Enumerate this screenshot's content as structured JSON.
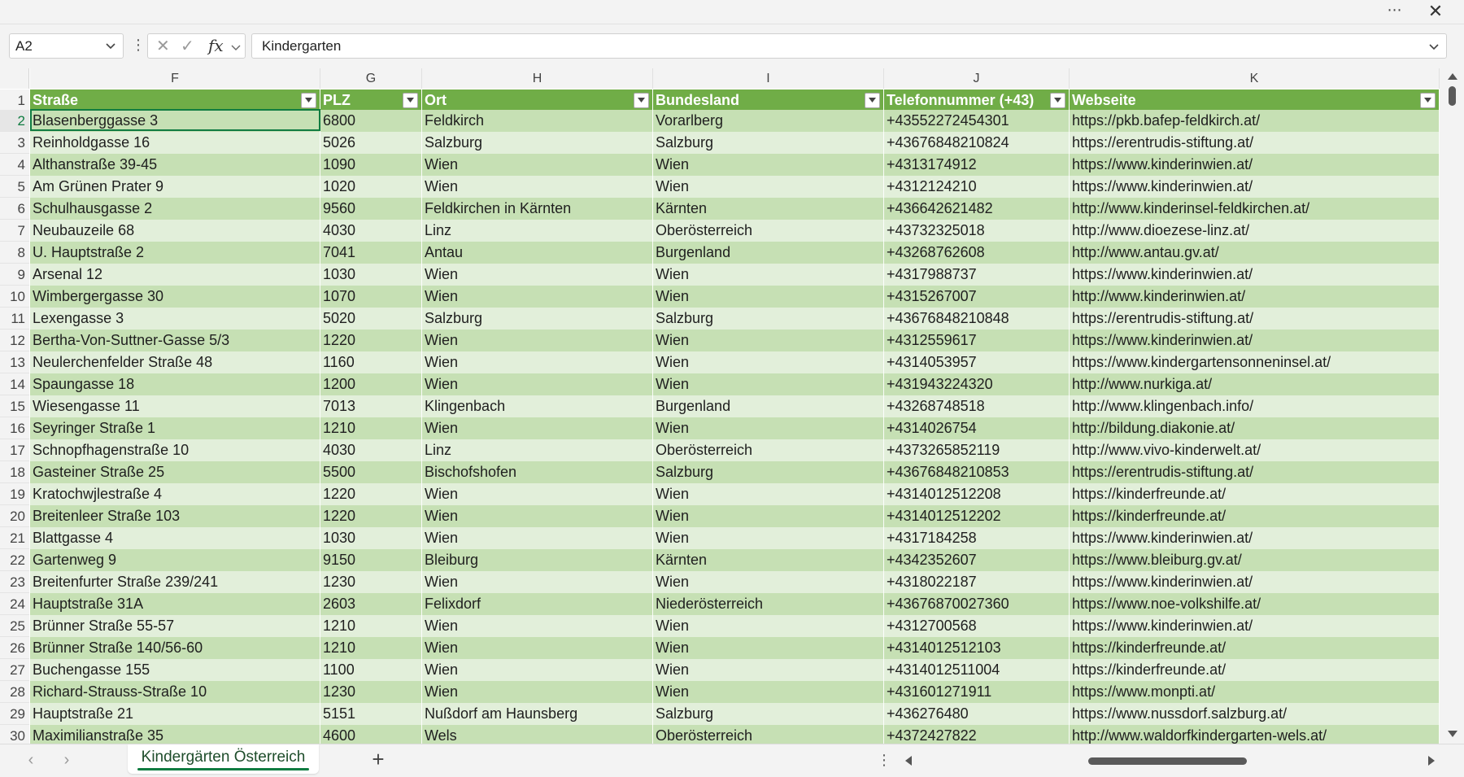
{
  "window": {
    "more_label": "⋯",
    "close_label": "✕"
  },
  "formula_bar": {
    "name_box": "A2",
    "cancel_symbol": "✕",
    "enter_symbol": "✓",
    "fx_label": "fx",
    "content": "Kindergarten"
  },
  "sheet": {
    "columns": [
      "F",
      "G",
      "H",
      "I",
      "J",
      "K"
    ],
    "header_row_number": "1",
    "headers": [
      "Straße",
      "PLZ",
      "Ort",
      "Bundesland",
      "Telefonnummer (+43)",
      "Webseite"
    ],
    "rows": [
      {
        "n": "2",
        "cells": [
          "Blasenberggasse 3",
          "6800",
          "Feldkirch",
          "Vorarlberg",
          "+43552272454301",
          "https://pkb.bafep-feldkirch.at/"
        ]
      },
      {
        "n": "3",
        "cells": [
          "Reinholdgasse 16",
          "5026",
          "Salzburg",
          "Salzburg",
          "+43676848210824",
          "https://erentrudis-stiftung.at/"
        ]
      },
      {
        "n": "4",
        "cells": [
          "Althanstraße 39-45",
          "1090",
          "Wien",
          "Wien",
          "+4313174912",
          "https://www.kinderinwien.at/"
        ]
      },
      {
        "n": "5",
        "cells": [
          "Am Grünen Prater 9",
          "1020",
          "Wien",
          "Wien",
          "+4312124210",
          "https://www.kinderinwien.at/"
        ]
      },
      {
        "n": "6",
        "cells": [
          "Schulhausgasse 2",
          "9560",
          "Feldkirchen in Kärnten",
          "Kärnten",
          "+436642621482",
          "http://www.kinderinsel-feldkirchen.at/"
        ]
      },
      {
        "n": "7",
        "cells": [
          "Neubauzeile 68",
          "4030",
          "Linz",
          "Oberösterreich",
          "+43732325018",
          "http://www.dioezese-linz.at/"
        ]
      },
      {
        "n": "8",
        "cells": [
          "U. Hauptstraße 2",
          "7041",
          "Antau",
          "Burgenland",
          "+43268762608",
          "http://www.antau.gv.at/"
        ]
      },
      {
        "n": "9",
        "cells": [
          "Arsenal 12",
          "1030",
          "Wien",
          "Wien",
          "+4317988737",
          "https://www.kinderinwien.at/"
        ]
      },
      {
        "n": "10",
        "cells": [
          "Wimbergergasse 30",
          "1070",
          "Wien",
          "Wien",
          "+4315267007",
          "http://www.kinderinwien.at/"
        ]
      },
      {
        "n": "11",
        "cells": [
          "Lexengasse 3",
          "5020",
          "Salzburg",
          "Salzburg",
          "+43676848210848",
          "https://erentrudis-stiftung.at/"
        ]
      },
      {
        "n": "12",
        "cells": [
          "Bertha-Von-Suttner-Gasse 5/3",
          "1220",
          "Wien",
          "Wien",
          "+4312559617",
          "https://www.kinderinwien.at/"
        ]
      },
      {
        "n": "13",
        "cells": [
          "Neulerchenfelder Straße 48",
          "1160",
          "Wien",
          "Wien",
          "+4314053957",
          "https://www.kindergartensonneninsel.at/"
        ]
      },
      {
        "n": "14",
        "cells": [
          "Spaungasse 18",
          "1200",
          "Wien",
          "Wien",
          "+431943224320",
          "http://www.nurkiga.at/"
        ]
      },
      {
        "n": "15",
        "cells": [
          "Wiesengasse 11",
          "7013",
          "Klingenbach",
          "Burgenland",
          "+43268748518",
          "http://www.klingenbach.info/"
        ]
      },
      {
        "n": "16",
        "cells": [
          "Seyringer Straße 1",
          "1210",
          "Wien",
          "Wien",
          "+4314026754",
          "http://bildung.diakonie.at/"
        ]
      },
      {
        "n": "17",
        "cells": [
          "Schnopfhagenstraße 10",
          "4030",
          "Linz",
          "Oberösterreich",
          "+4373265852119",
          "http://www.vivo-kinderwelt.at/"
        ]
      },
      {
        "n": "18",
        "cells": [
          "Gasteiner Straße 25",
          "5500",
          "Bischofshofen",
          "Salzburg",
          "+43676848210853",
          "https://erentrudis-stiftung.at/"
        ]
      },
      {
        "n": "19",
        "cells": [
          "Kratochwjlestraße 4",
          "1220",
          "Wien",
          "Wien",
          "+4314012512208",
          "https://kinderfreunde.at/"
        ]
      },
      {
        "n": "20",
        "cells": [
          "Breitenleer Straße 103",
          "1220",
          "Wien",
          "Wien",
          "+4314012512202",
          "https://kinderfreunde.at/"
        ]
      },
      {
        "n": "21",
        "cells": [
          "Blattgasse 4",
          "1030",
          "Wien",
          "Wien",
          "+4317184258",
          "https://www.kinderinwien.at/"
        ]
      },
      {
        "n": "22",
        "cells": [
          "Gartenweg 9",
          "9150",
          "Bleiburg",
          "Kärnten",
          "+4342352607",
          "https://www.bleiburg.gv.at/"
        ]
      },
      {
        "n": "23",
        "cells": [
          "Breitenfurter Straße 239/241",
          "1230",
          "Wien",
          "Wien",
          "+4318022187",
          "https://www.kinderinwien.at/"
        ]
      },
      {
        "n": "24",
        "cells": [
          "Hauptstraße 31A",
          "2603",
          "Felixdorf",
          "Niederösterreich",
          "+43676870027360",
          "https://www.noe-volkshilfe.at/"
        ]
      },
      {
        "n": "25",
        "cells": [
          "Brünner Straße 55-57",
          "1210",
          "Wien",
          "Wien",
          "+4312700568",
          "https://www.kinderinwien.at/"
        ]
      },
      {
        "n": "26",
        "cells": [
          "Brünner Straße 140/56-60",
          "1210",
          "Wien",
          "Wien",
          "+4314012512103",
          "https://kinderfreunde.at/"
        ]
      },
      {
        "n": "27",
        "cells": [
          "Buchengasse 155",
          "1100",
          "Wien",
          "Wien",
          "+4314012511004",
          "https://kinderfreunde.at/"
        ]
      },
      {
        "n": "28",
        "cells": [
          "Richard-Strauss-Straße 10",
          "1230",
          "Wien",
          "Wien",
          "+431601271911",
          "https://www.monpti.at/"
        ]
      },
      {
        "n": "29",
        "cells": [
          "Hauptstraße 21",
          "5151",
          "Nußdorf am Haunsberg",
          "Salzburg",
          "+436276480",
          "https://www.nussdorf.salzburg.at/"
        ]
      },
      {
        "n": "30",
        "cells": [
          "Maximilianstraße 35",
          "4600",
          "Wels",
          "Oberösterreich",
          "+4372427822",
          "http://www.waldorfkindergarten-wels.at/"
        ]
      }
    ],
    "colors": {
      "header_fill": "#70ad47",
      "band_dark": "#c6e0b4",
      "band_light": "#e2efda",
      "accent": "#107c41"
    }
  },
  "tabs": {
    "prev_label": "‹",
    "next_label": "›",
    "sheet_name": "Kindergärten Österreich",
    "add_label": "+",
    "more_label": "⋮"
  }
}
